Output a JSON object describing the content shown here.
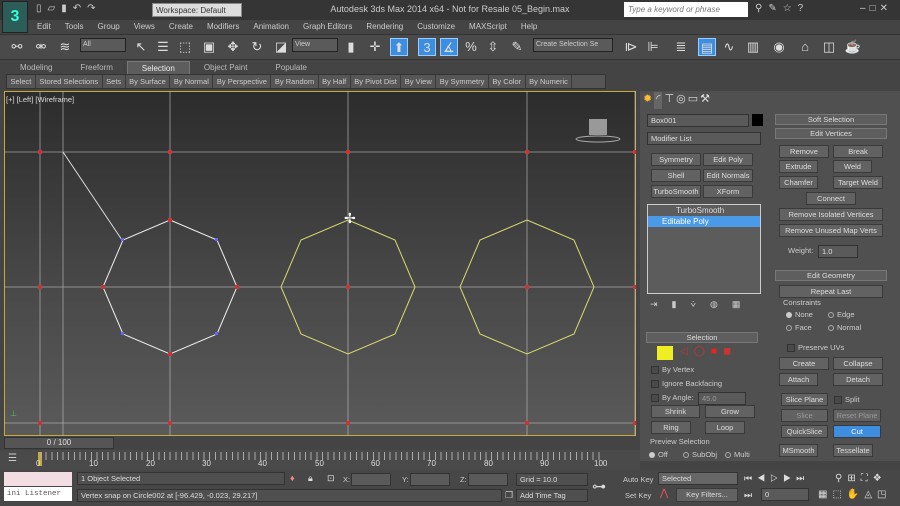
{
  "titlebar": {
    "workspace": "Workspace: Default",
    "title": "Autodesk 3ds Max  2014 x64  - Not for Resale    05_Begin.max",
    "search_placeholder": "Type a keyword or phrase"
  },
  "menu": [
    "Edit",
    "Tools",
    "Group",
    "Views",
    "Create",
    "Modifiers",
    "Animation",
    "Graph Editors",
    "Rendering",
    "Customize",
    "MAXScript",
    "Help"
  ],
  "toolbar": {
    "filter": "All",
    "ref_coord": "View",
    "selection_set": "Create Selection Se"
  },
  "ribbon": {
    "tabs": [
      "Modeling",
      "Freeform",
      "Selection",
      "Object Paint",
      "Populate"
    ],
    "active": "Selection",
    "subtabs": [
      "Select",
      "Stored Selections",
      "Sets",
      "By Surface",
      "By Normal",
      "By Perspective",
      "By Random",
      "By Half",
      "By Pivot Dist",
      "By View",
      "By Symmetry",
      "By Color",
      "By Numeric"
    ]
  },
  "viewport": {
    "label": "[+] [Left] [Wireframe]"
  },
  "command_panel": {
    "object_name": "Box001",
    "modifier_list": "Modifier List",
    "modifier_buttons": [
      "Symmetry",
      "Edit Poly",
      "Shell",
      "Edit Normals",
      "TurboSmooth",
      "XForm"
    ],
    "stack": [
      "TurboSmooth",
      "Editable Poly"
    ],
    "selection": {
      "title": "Selection",
      "by_vertex": "By Vertex",
      "ignore_backfacing": "Ignore Backfacing",
      "by_angle": "By Angle:",
      "angle": "45.0",
      "shrink": "Shrink",
      "grow": "Grow",
      "ring": "Ring",
      "loop": "Loop",
      "preview": "Preview Selection",
      "off": "Off",
      "subobj": "SubObj",
      "multi": "Multi"
    },
    "soft_selection": "Soft Selection",
    "edit_vertices": {
      "title": "Edit Vertices",
      "remove": "Remove",
      "break": "Break",
      "extrude": "Extrude",
      "weld": "Weld",
      "chamfer": "Chamfer",
      "target_weld": "Target Weld",
      "connect": "Connect",
      "remove_isolated": "Remove Isolated Vertices",
      "remove_unused": "Remove Unused Map Verts",
      "weight_label": "Weight:",
      "weight": "1.0"
    },
    "edit_geometry": {
      "title": "Edit Geometry",
      "repeat_last": "Repeat Last",
      "constraints": "Constraints",
      "none": "None",
      "edge": "Edge",
      "face": "Face",
      "normal": "Normal",
      "preserve_uvs": "Preserve UVs",
      "create": "Create",
      "collapse": "Collapse",
      "attach": "Attach",
      "detach": "Detach",
      "slice_plane": "Slice Plane",
      "split": "Split",
      "slice": "Slice",
      "reset_plane": "Reset Plane",
      "quickslice": "QuickSlice",
      "cut": "Cut",
      "msmooth": "MSmooth",
      "tessellate": "Tessellate"
    }
  },
  "timeline": {
    "frame": "0 / 100",
    "ticks": [
      "0",
      "10",
      "20",
      "30",
      "40",
      "50",
      "60",
      "70",
      "80",
      "90",
      "100"
    ],
    "progress": 0
  },
  "status": {
    "listener": "ini Listener",
    "selected": "1 Object Selected",
    "prompt": "Vertex snap on Circle002 at [-96.429, -0.023, 29.217]",
    "x": "X:",
    "y": "Y:",
    "z": "Z:",
    "grid": "Grid = 10.0",
    "add_time_tag": "Add Time Tag",
    "auto_key": "Auto Key",
    "set_key": "Set Key",
    "key_mode": "Selected",
    "key_filters": "Key Filters...",
    "current_frame": "0"
  },
  "colors": {
    "accent": "#3d8ee0",
    "viewport_border": "#c9a93a",
    "selected_spline": "#d8d870"
  }
}
